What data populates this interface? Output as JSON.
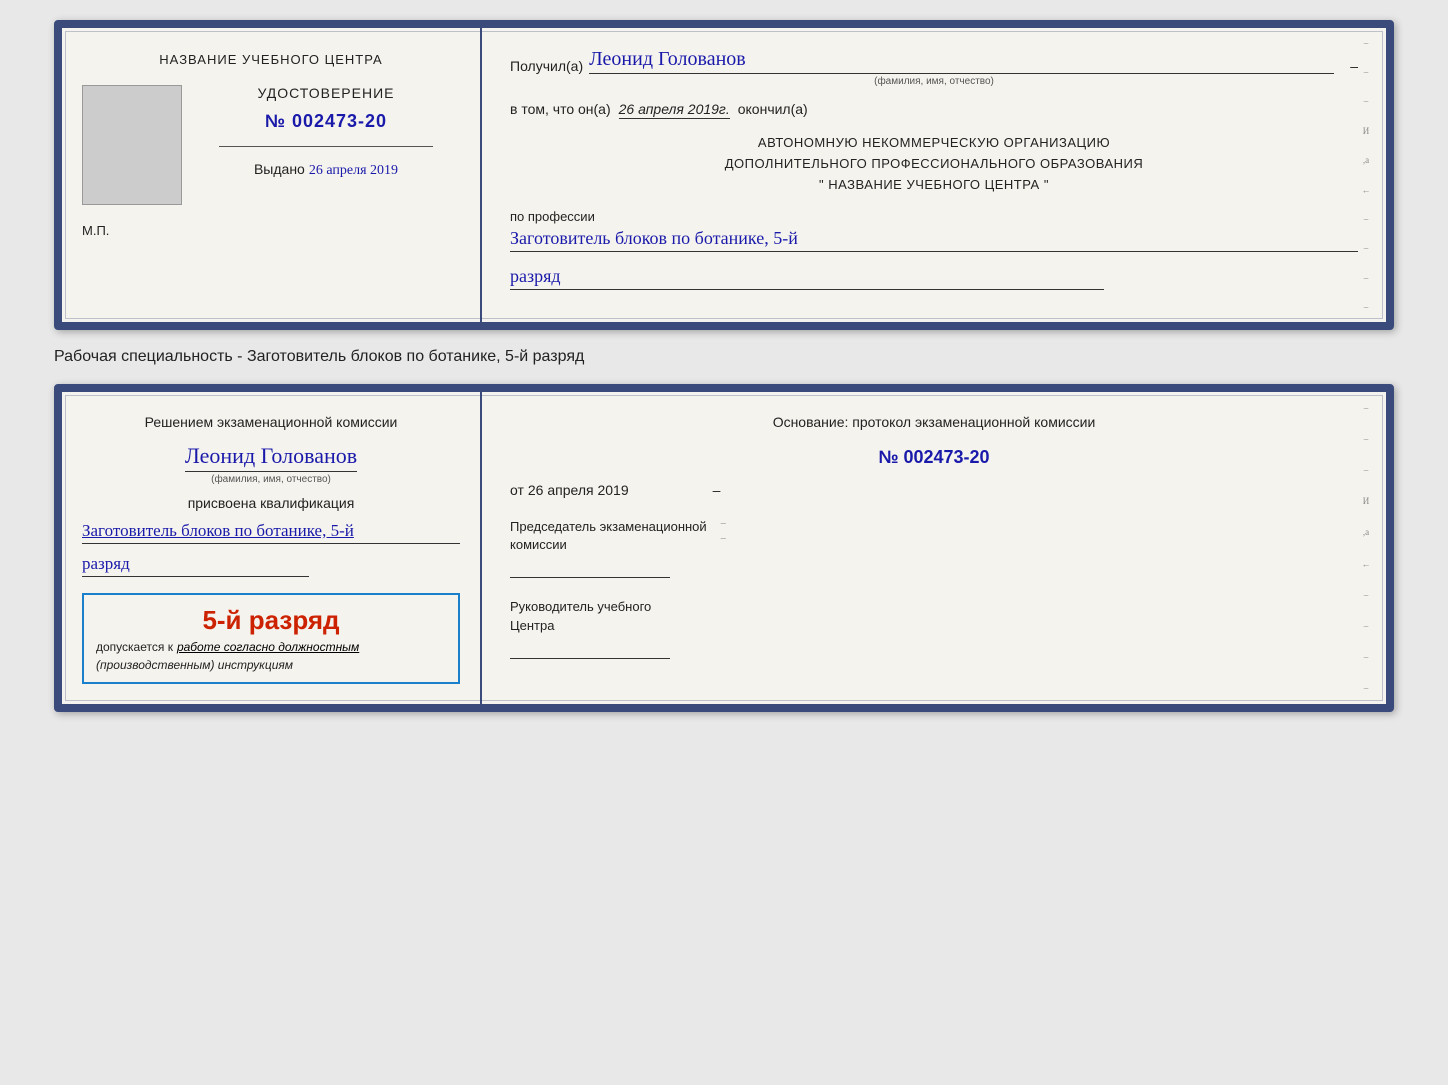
{
  "doc1": {
    "left": {
      "center_title": "НАЗВАНИЕ УЧЕБНОГО ЦЕНТРА",
      "cert_label": "УДОСТОВЕРЕНИЕ",
      "cert_number": "№ 002473-20",
      "issued_label": "Выдано",
      "issued_date": "26 апреля 2019",
      "mp_label": "М.П."
    },
    "right": {
      "received_label": "Получил(а)",
      "recipient_name": "Леонид Голованов",
      "name_sub": "(фамилия, имя, отчество)",
      "confirm_prefix": "в том, что он(а)",
      "confirm_date": "26 апреля 2019г.",
      "confirm_suffix": "окончил(а)",
      "org_line1": "АВТОНОМНУЮ НЕКОММЕРЧЕСКУЮ ОРГАНИЗАЦИЮ",
      "org_line2": "ДОПОЛНИТЕЛЬНОГО ПРОФЕССИОНАЛЬНОГО ОБРАЗОВАНИЯ",
      "org_line3": "\"  НАЗВАНИЕ УЧЕБНОГО ЦЕНТРА  \"",
      "profession_label": "по профессии",
      "profession_value": "Заготовитель блоков по ботанике, 5-й",
      "rank_value": "разряд",
      "deco_chars": [
        "–",
        "–",
        "–",
        "–",
        "И",
        ",а",
        "←",
        "–",
        "–",
        "–",
        "–",
        "–"
      ]
    }
  },
  "specialty_label": "Рабочая специальность - Заготовитель блоков по ботанике, 5-й разряд",
  "doc2": {
    "left": {
      "commission_text": "Решением экзаменационной комиссии",
      "person_name": "Леонид Голованов",
      "name_sub": "(фамилия, имя, отчество)",
      "assigned_label": "присвоена квалификация",
      "qual_value": "Заготовитель блоков по ботанике, 5-й",
      "rank_value": "разряд",
      "badge_rank": "5-й разряд",
      "badge_allowed_label": "допускается к",
      "badge_allowed_value": "работе согласно должностным",
      "badge_instruction": "(производственным) инструкциям"
    },
    "right": {
      "basis_label": "Основание: протокол экзаменационной комиссии",
      "proto_number": "№  002473-20",
      "date_prefix": "от",
      "date_value": "26 апреля 2019",
      "chairman_label": "Председатель экзаменационной",
      "chairman_label2": "комиссии",
      "director_label": "Руководитель учебного",
      "director_label2": "Центра",
      "deco_chars": [
        "–",
        "–",
        "–",
        "–",
        "И",
        ",а",
        "←",
        "–",
        "–",
        "–",
        "–",
        "–"
      ]
    }
  }
}
